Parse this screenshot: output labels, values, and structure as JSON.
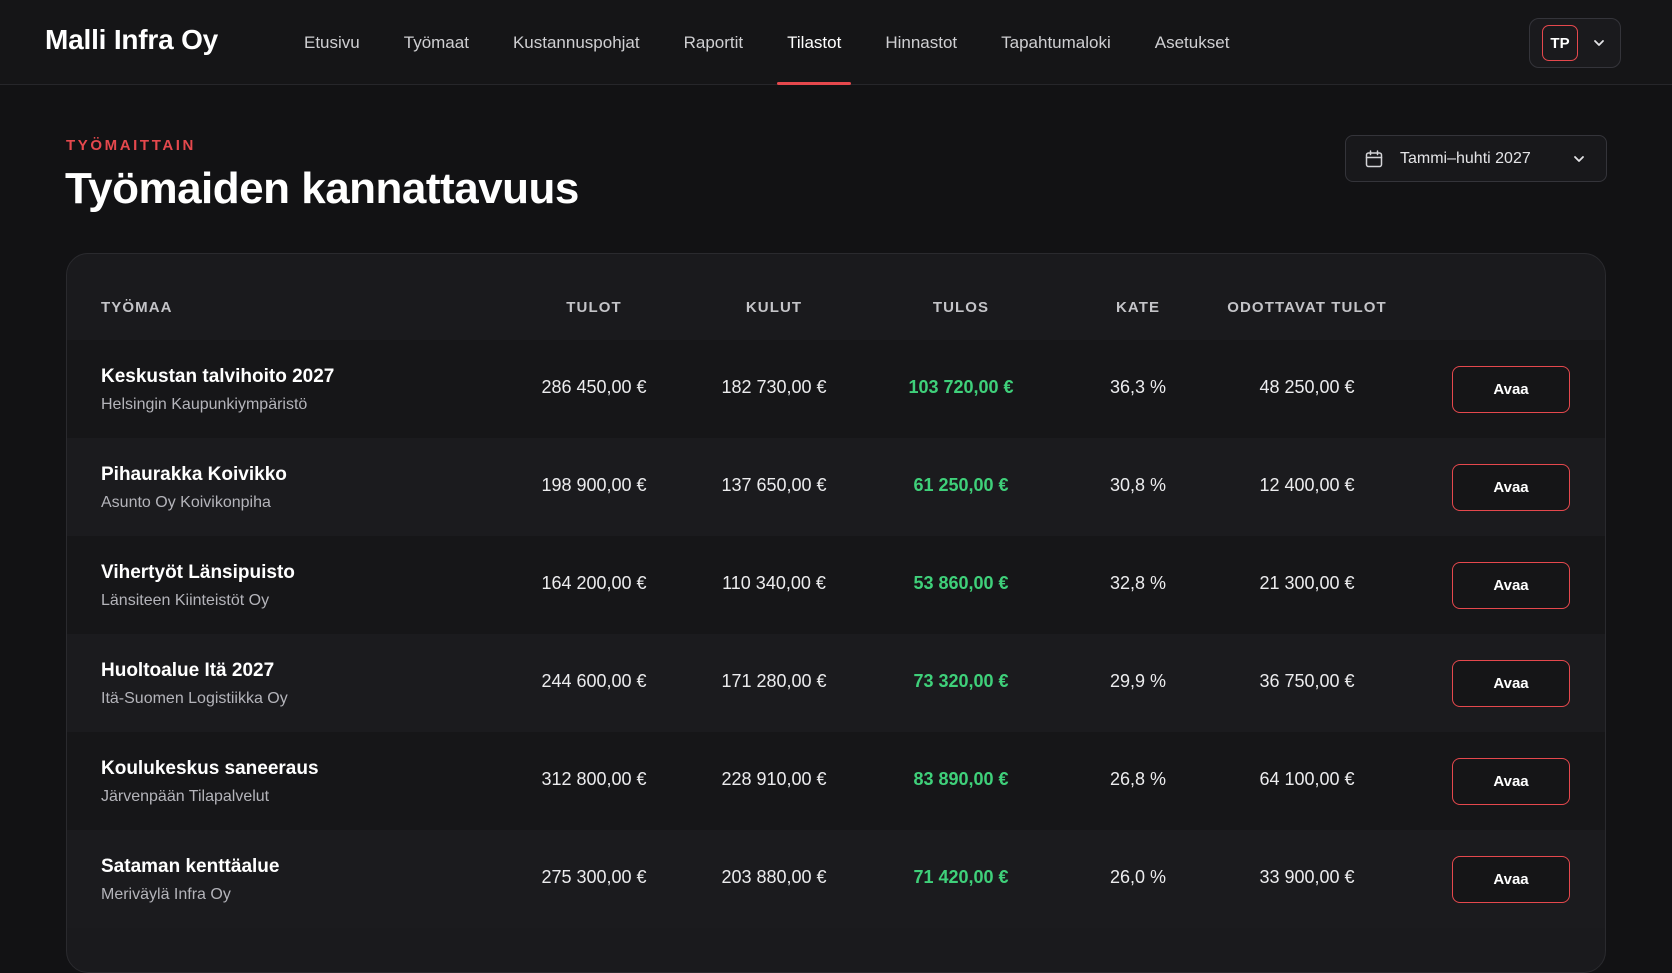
{
  "app": {
    "brand": "Malli Infra Oy"
  },
  "nav": {
    "items": [
      {
        "label": "Etusivu",
        "active": false
      },
      {
        "label": "Työmaat",
        "active": false
      },
      {
        "label": "Kustannuspohjat",
        "active": false
      },
      {
        "label": "Raportit",
        "active": false
      },
      {
        "label": "Tilastot",
        "active": true
      },
      {
        "label": "Hinnastot",
        "active": false
      },
      {
        "label": "Tapahtumaloki",
        "active": false
      },
      {
        "label": "Asetukset",
        "active": false
      }
    ]
  },
  "user": {
    "initials": "TP",
    "menu_icon": "chevron-down-icon"
  },
  "page": {
    "eyebrow": "TYÖMAITTAIN",
    "title": "Työmaiden kannattavuus",
    "period": {
      "label": "Tammi–huhti 2027",
      "icon": "calendar-icon"
    }
  },
  "table": {
    "columns": {
      "site": "TYÖMAA",
      "income": "TULOT",
      "costs": "KULUT",
      "result": "TULOS",
      "margin": "KATE",
      "pending": "ODOTTAVAT TULOT"
    },
    "rows": [
      {
        "name": "Keskustan talvihoito 2027",
        "client": "Helsingin Kaupunkiympäristö",
        "income": "286 450,00 €",
        "costs": "182 730,00 €",
        "result": "103 720,00 €",
        "margin": "36,3 %",
        "pending": "48 250,00 €",
        "action": "Avaa"
      },
      {
        "name": "Pihaurakka Koivikko",
        "client": "Asunto Oy Koivikonpiha",
        "income": "198 900,00 €",
        "costs": "137 650,00 €",
        "result": "61 250,00 €",
        "margin": "30,8 %",
        "pending": "12 400,00 €",
        "action": "Avaa"
      },
      {
        "name": "Vihertyöt Länsipuisto",
        "client": "Länsiteen Kiinteistöt Oy",
        "income": "164 200,00 €",
        "costs": "110 340,00 €",
        "result": "53 860,00 €",
        "margin": "32,8 %",
        "pending": "21 300,00 €",
        "action": "Avaa"
      },
      {
        "name": "Huoltoalue Itä 2027",
        "client": "Itä-Suomen Logistiikka Oy",
        "income": "244 600,00 €",
        "costs": "171 280,00 €",
        "result": "73 320,00 €",
        "margin": "29,9 %",
        "pending": "36 750,00 €",
        "action": "Avaa"
      },
      {
        "name": "Koulukeskus saneeraus",
        "client": "Järvenpään Tilapalvelut",
        "income": "312 800,00 €",
        "costs": "228 910,00 €",
        "result": "83 890,00 €",
        "margin": "26,8 %",
        "pending": "64 100,00 €",
        "action": "Avaa"
      },
      {
        "name": "Sataman kenttäalue",
        "client": "Meriväylä Infra Oy",
        "income": "275 300,00 €",
        "costs": "203 880,00 €",
        "result": "71 420,00 €",
        "margin": "26,0 %",
        "pending": "33 900,00 €",
        "action": "Avaa"
      }
    ]
  },
  "colors": {
    "accent": "#e5484d",
    "positive": "#3fd07a",
    "background": "#121214",
    "surface": "#1a1a1d"
  }
}
